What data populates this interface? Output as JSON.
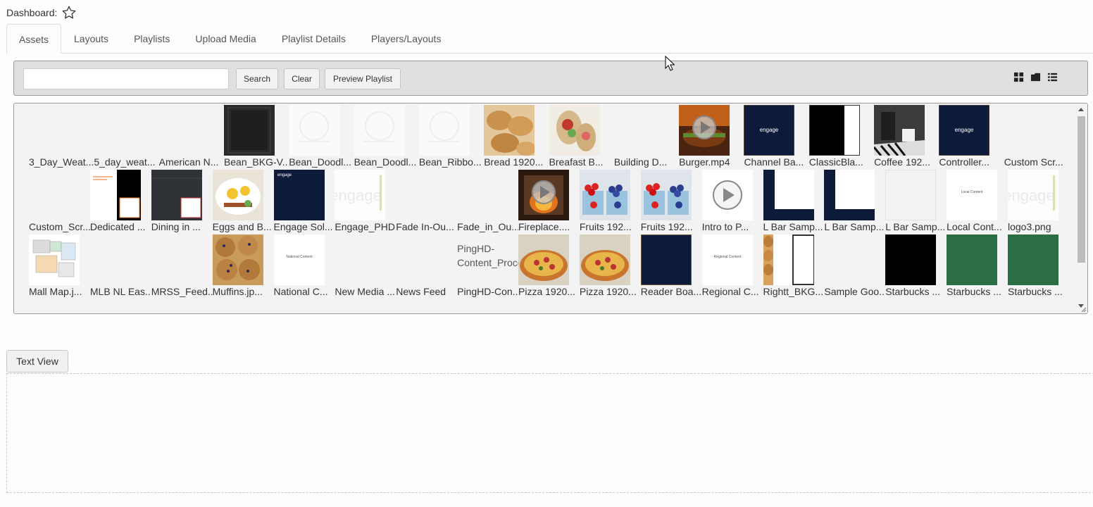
{
  "header": {
    "title": "Dashboard:"
  },
  "tabs": [
    {
      "label": "Assets",
      "active": true
    },
    {
      "label": "Layouts"
    },
    {
      "label": "Playlists"
    },
    {
      "label": "Upload Media"
    },
    {
      "label": "Playlist Details"
    },
    {
      "label": "Players/Layouts"
    }
  ],
  "toolbar": {
    "search_value": "",
    "search_label": "Search",
    "clear_label": "Clear",
    "preview_label": "Preview Playlist",
    "view_icons": [
      "grid-view-icon",
      "folder-view-icon",
      "list-view-icon"
    ]
  },
  "gallery": {
    "rows": [
      [
        {
          "label": "3_Day_Weat...",
          "thumb": "none"
        },
        {
          "label": "5_day_weat...",
          "thumb": "none"
        },
        {
          "label": "American N...",
          "thumb": "none"
        },
        {
          "label": "Bean_BKG-V...",
          "thumb": "dark-texture"
        },
        {
          "label": "Bean_Doodl...",
          "thumb": "faint-doodle"
        },
        {
          "label": "Bean_Doodl...",
          "thumb": "faint-doodle"
        },
        {
          "label": "Bean_Ribbo...",
          "thumb": "faint-doodle"
        },
        {
          "label": "Bread 1920...",
          "thumb": "bread"
        },
        {
          "label": "Breafast B...",
          "thumb": "wrap"
        },
        {
          "label": "Building D...",
          "thumb": "none"
        },
        {
          "label": "Burger.mp4",
          "thumb": "burger-video"
        },
        {
          "label": "Channel Ba...",
          "thumb": "navy-logo"
        },
        {
          "label": "ClassicBla...",
          "thumb": "black-white"
        },
        {
          "label": "Coffee 192...",
          "thumb": "coffee"
        },
        {
          "label": "Controller...",
          "thumb": "navy-logo"
        },
        {
          "label": "Custom Scr...",
          "thumb": "none"
        }
      ],
      [
        {
          "label": "Custom_Scr...",
          "thumb": "none"
        },
        {
          "label": "Dedicated ...",
          "thumb": "dedicated"
        },
        {
          "label": "Dining in ...",
          "thumb": "slate"
        },
        {
          "label": "Eggs and B...",
          "thumb": "eggs"
        },
        {
          "label": "Engage Sol...",
          "thumb": "navy-small"
        },
        {
          "label": "Engage_PHD...",
          "thumb": "white-logo"
        },
        {
          "label": "Fade In-Ou...",
          "thumb": "none"
        },
        {
          "label": "Fade_in_Ou...",
          "thumb": "none"
        },
        {
          "label": "Fireplace....",
          "thumb": "fire-video"
        },
        {
          "label": "Fruits 192...",
          "thumb": "berries"
        },
        {
          "label": "Fruits 192...",
          "thumb": "berries"
        },
        {
          "label": "Intro to P...",
          "thumb": "play-white"
        },
        {
          "label": "L Bar Samp...",
          "thumb": "lbar"
        },
        {
          "label": "L Bar Samp...",
          "thumb": "lbar"
        },
        {
          "label": "L Bar Samp...",
          "thumb": "lbar-light"
        },
        {
          "label": "Local Cont...",
          "thumb": "local-content"
        },
        {
          "label": "logo3.png",
          "thumb": "white-logo"
        }
      ],
      [
        {
          "label": "Mall Map.j...",
          "thumb": "map"
        },
        {
          "label": "MLB NL Eas...",
          "thumb": "none"
        },
        {
          "label": "MRSS_Feed....",
          "thumb": "none"
        },
        {
          "label": "Muffins.jp...",
          "thumb": "muffins"
        },
        {
          "label": "National C...",
          "thumb": "national"
        },
        {
          "label": "New Media ...",
          "thumb": "none"
        },
        {
          "label": "News Feed",
          "thumb": "none"
        },
        {
          "label": "PingHD-Con...",
          "thumb": "broken",
          "alt": "PingHD-Content_Proce"
        },
        {
          "label": "Pizza 1920...",
          "thumb": "pizza"
        },
        {
          "label": "Pizza 1920...",
          "thumb": "pizza"
        },
        {
          "label": "Reader Boa...",
          "thumb": "navy-plain"
        },
        {
          "label": "Regional C...",
          "thumb": "regional"
        },
        {
          "label": "Rightt_BKG...",
          "thumb": "bread-strip"
        },
        {
          "label": "Sample Goo...",
          "thumb": "none"
        },
        {
          "label": "Starbucks ...",
          "thumb": "black"
        },
        {
          "label": "Starbucks ...",
          "thumb": "green"
        },
        {
          "label": "Starbucks ...",
          "thumb": "green"
        }
      ]
    ],
    "thumb_text": {
      "engage": "engage",
      "local": "Local Content",
      "national": "National Content",
      "regional": "Regional Content"
    }
  },
  "text_view": {
    "label": "Text View"
  },
  "colors": {
    "navy": "#0d1a3a",
    "green": "#2b6e46",
    "toolbar_bg": "#e0e0e0"
  }
}
